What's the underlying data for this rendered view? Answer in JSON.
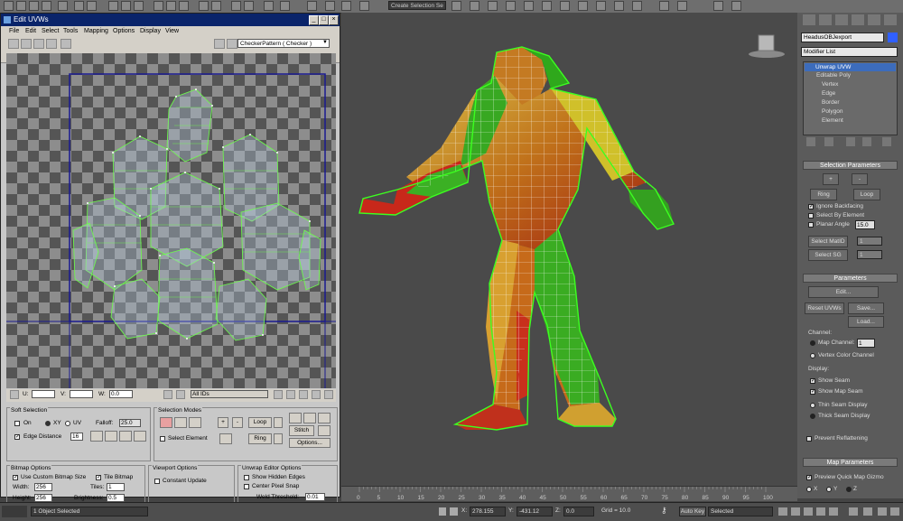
{
  "top_toolbar": {
    "fields": [
      "Create Selection Se"
    ]
  },
  "viewport": {
    "label": ""
  },
  "uvw_window": {
    "title": "Edit UVWs",
    "menu": [
      "File",
      "Edit",
      "Select",
      "Tools",
      "Mapping",
      "Options",
      "Display",
      "View"
    ],
    "checker_select": "CheckerPattern  ( Checker )",
    "bottom": {
      "u_label": "U:",
      "v_label": "V:",
      "w_label": "W:",
      "w_value": "0.0",
      "ids_select": "All IDs"
    },
    "soft_selection": {
      "title": "Soft Selection",
      "on_label": "On",
      "xy_label": "XY",
      "uv_label": "UV",
      "falloff_label": "Falloff:",
      "falloff_value": "25.0",
      "edge_distance_label": "Edge Distance",
      "edge_distance_value": "16"
    },
    "selection_modes": {
      "title": "Selection Modes",
      "loop_label": "Loop",
      "ring_label": "Ring",
      "select_element_label": "Select Element",
      "stitch_label": "Stitch",
      "options_label": "Options..."
    },
    "bitmap_options": {
      "title": "Bitmap Options",
      "use_custom_label": "Use Custom Bitmap Size",
      "tile_bitmap_label": "Tile Bitmap",
      "width_label": "Width:",
      "width_value": "256",
      "height_label": "Height:",
      "height_value": "256",
      "tiles_label": "Tiles:",
      "tiles_value": "1",
      "brightness_label": "Brightness:",
      "brightness_value": "0.5"
    },
    "viewport_options": {
      "title": "Viewport Options",
      "constant_update_label": "Constant Update"
    },
    "unwrap_editor_options": {
      "title": "Unwrap Editor Options",
      "show_hidden_edges_label": "Show Hidden Edges",
      "center_pixel_snap_label": "Center Pixel Snap",
      "weld_threshold_label": "Weld Threshold:",
      "weld_threshold_value": "0.01"
    }
  },
  "command_panel": {
    "object_name": "HeadusOBJexport",
    "modifier_list": "Modifier List",
    "stack": [
      "Unwrap UVW",
      "Editable Poly",
      "Vertex",
      "Edge",
      "Border",
      "Polygon",
      "Element"
    ],
    "selection_parameters": {
      "title": "Selection Parameters",
      "plus": "+",
      "minus": "-",
      "ring": "Ring",
      "loop": "Loop",
      "ignore_backfacing": "Ignore Backfacing",
      "select_by_element": "Select By Element",
      "planar_angle": "Planar Angle",
      "planar_angle_value": "15.0",
      "select_matid": "Select MatID",
      "select_matid_value": "1",
      "select_sg": "Select SG",
      "select_sg_value": "1"
    },
    "parameters": {
      "title": "Parameters",
      "edit": "Edit...",
      "reset_uvws": "Reset UVWs",
      "save": "Save...",
      "load": "Load...",
      "channel_label": "Channel:",
      "map_channel": "Map Channel:",
      "map_channel_value": "1",
      "vertex_color_channel": "Vertex Color Channel",
      "display_label": "Display:",
      "show_seam": "Show Seam",
      "show_map_seam": "Show Map Seam",
      "thin_seam_display": "Thin Seam Display",
      "thick_seam_display": "Thick Seam Display",
      "prevent_reflattening": "Prevent Reflattening"
    },
    "map_parameters": {
      "title": "Map Parameters",
      "preview_quick_map_gizmo": "Preview Quick Map Gizmo",
      "x": "X",
      "y": "Y",
      "z": "Z"
    }
  },
  "timeline": {
    "ticks": [
      "0",
      "5",
      "10",
      "15",
      "20",
      "25",
      "30",
      "35",
      "40",
      "45",
      "50",
      "55",
      "60",
      "65",
      "70",
      "75",
      "80",
      "85",
      "90",
      "95",
      "100"
    ]
  },
  "status_bar": {
    "selection_text": "1 Object Selected",
    "x_label": "X:",
    "x_value": "278.155",
    "y_label": "Y:",
    "y_value": "-431.12",
    "z_label": "Z:",
    "z_value": "0.0",
    "grid": "Grid = 10.0",
    "auto_key": "Auto Key",
    "selected": "Selected"
  }
}
